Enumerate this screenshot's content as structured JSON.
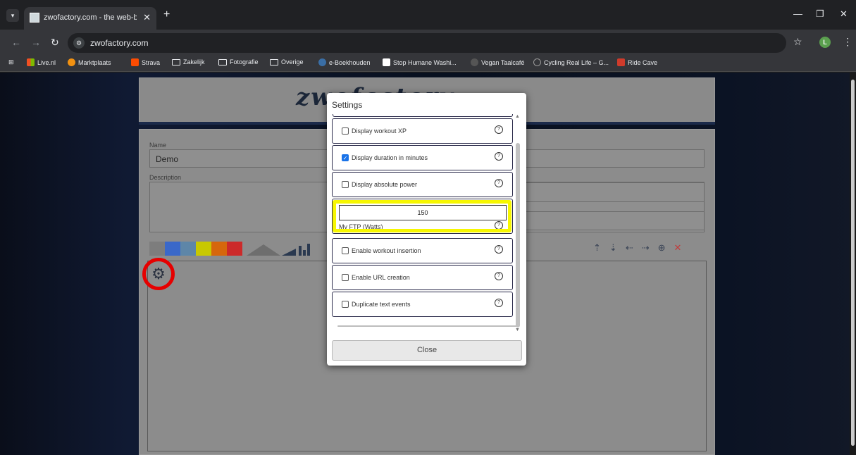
{
  "browser": {
    "tab_title": "zwofactory.com - the web-base",
    "tab_close": "✕",
    "new_tab": "+",
    "url": "zwofactory.com",
    "profile_initial": "L",
    "bookmarks": [
      {
        "label": "Live.nl",
        "icon": "windows-icon"
      },
      {
        "label": "Marktplaats",
        "icon": "marktplaats-icon"
      },
      {
        "label": "Strava",
        "icon": "strava-icon"
      },
      {
        "label": "Zakelijk",
        "icon": "folder-icon"
      },
      {
        "label": "Fotografie",
        "icon": "folder-icon"
      },
      {
        "label": "Overige",
        "icon": "folder-icon"
      },
      {
        "label": "e-Boekhouden",
        "icon": "eboekhouden-icon"
      },
      {
        "label": "Stop Humane Washi...",
        "icon": "bookmark-icon"
      },
      {
        "label": "Vegan Taalcafé",
        "icon": "bookmark-icon"
      },
      {
        "label": "Cycling Real Life – G...",
        "icon": "globe-icon"
      },
      {
        "label": "Ride Cave",
        "icon": "ridecave-icon"
      }
    ]
  },
  "site": {
    "logo_text": "zwofactory",
    "name_label": "Name",
    "name_value": "Demo",
    "description_label": "Description"
  },
  "colors": {
    "highlight": "#f7f700",
    "gear_ring": "#e60000",
    "swatches": [
      "#7d7d7d",
      "#3a68c9",
      "#5e86a8",
      "#c8c800",
      "#d6670c",
      "#cc2a2a"
    ]
  },
  "settings": {
    "title": "Settings",
    "options": [
      {
        "label": "Display workout XP",
        "checked": false
      },
      {
        "label": "Display duration in minutes",
        "checked": true
      },
      {
        "label": "Display absolute power",
        "checked": false
      },
      {
        "label": "Enable workout insertion",
        "checked": false
      },
      {
        "label": "Enable URL creation",
        "checked": false
      },
      {
        "label": "Duplicate text events",
        "checked": false
      }
    ],
    "ftp_value": "150",
    "ftp_label": "My FTP (Watts)",
    "help_glyph": "?",
    "close_label": "Close"
  }
}
